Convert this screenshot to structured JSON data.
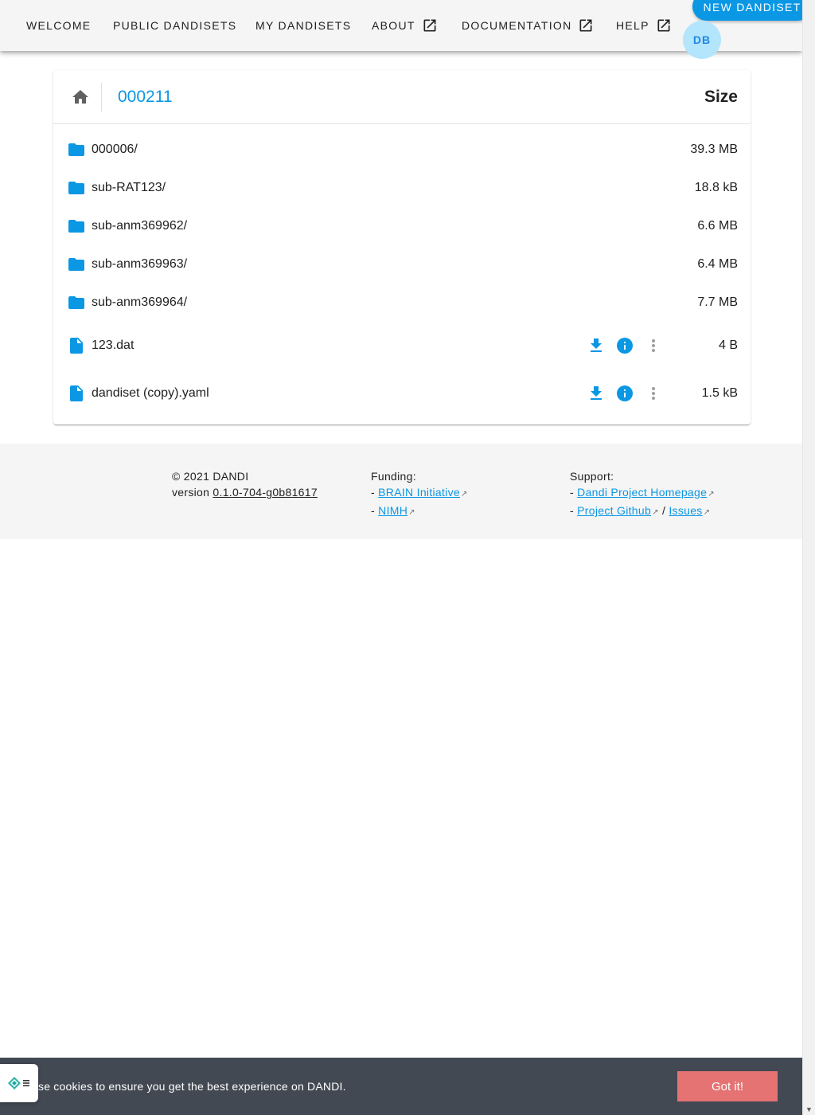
{
  "nav": {
    "items": [
      {
        "label": "WELCOME",
        "external": false
      },
      {
        "label": "PUBLIC DANDISETS",
        "external": false
      },
      {
        "label": "MY DANDISETS",
        "external": false
      },
      {
        "label": "ABOUT",
        "external": true
      },
      {
        "label": "DOCUMENTATION",
        "external": true
      },
      {
        "label": "HELP",
        "external": true
      }
    ],
    "new_button": "NEW DANDISET",
    "avatar_initials": "DB"
  },
  "browser": {
    "breadcrumb": "000211",
    "size_header": "Size",
    "rows": [
      {
        "type": "folder",
        "name": "000006/",
        "size": "39.3 MB"
      },
      {
        "type": "folder",
        "name": "sub-RAT123/",
        "size": "18.8 kB"
      },
      {
        "type": "folder",
        "name": "sub-anm369962/",
        "size": "6.6 MB"
      },
      {
        "type": "folder",
        "name": "sub-anm369963/",
        "size": "6.4 MB"
      },
      {
        "type": "folder",
        "name": "sub-anm369964/",
        "size": "7.7 MB"
      },
      {
        "type": "file",
        "name": "123.dat",
        "size": "4 B"
      },
      {
        "type": "file",
        "name": "dandiset (copy).yaml",
        "size": "1.5 kB"
      }
    ]
  },
  "footer": {
    "copyright": "© 2021 DANDI",
    "version_prefix": "version ",
    "version": "0.1.0-704-g0b81617",
    "funding_title": "Funding:",
    "funding_links": [
      "BRAIN Initiative",
      "NIMH"
    ],
    "support_title": "Support:",
    "support_links": [
      "Dandi Project Homepage",
      "Project Github",
      "Issues"
    ],
    "dash": "- ",
    "slash": " / "
  },
  "cookie": {
    "text": "se cookies to ensure you get the best experience on DANDI.",
    "button": "Got it!"
  },
  "colors": {
    "accent": "#0a97e4",
    "appbar": "#f5f5f5",
    "cookie_bar": "#424953",
    "cookie_button": "#e57373"
  }
}
